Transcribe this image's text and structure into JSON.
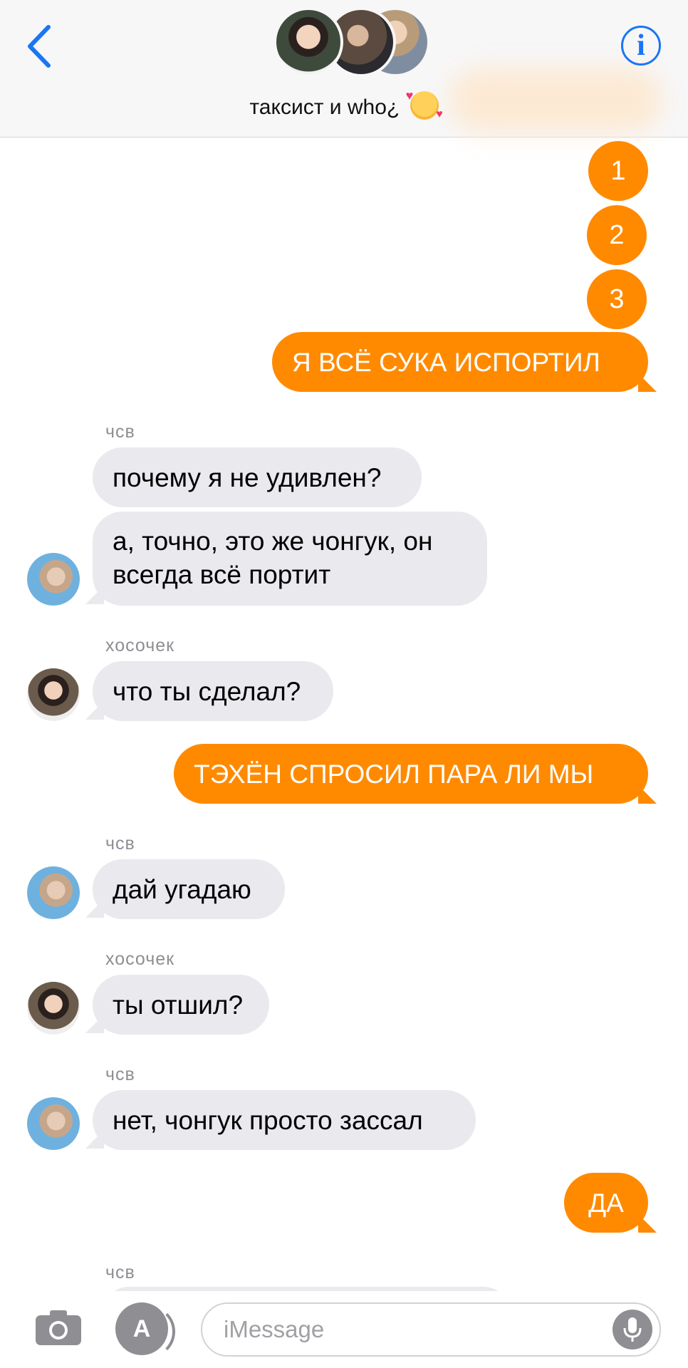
{
  "header": {
    "title": "таксист и who¿",
    "back_icon": "chevron-left",
    "info_icon": "info",
    "info_label": "i",
    "accent_color": "#1976f5"
  },
  "colors": {
    "outgoing": "#ff8a00",
    "incoming": "#e9e9ee",
    "sender_name": "#8e8e93"
  },
  "messages": [
    {
      "direction": "out",
      "text": "1"
    },
    {
      "direction": "out",
      "text": "2"
    },
    {
      "direction": "out",
      "text": "3"
    },
    {
      "direction": "out",
      "text": "Я ВСЁ СУКА ИСПОРТИЛ"
    },
    {
      "direction": "in",
      "sender": "чсв",
      "text": "почему я не удивлен?"
    },
    {
      "direction": "in",
      "sender": "чсв",
      "text": "а, точно, это же чонгук, он всегда всё портит"
    },
    {
      "direction": "in",
      "sender": "хосочек",
      "text": "что ты сделал?"
    },
    {
      "direction": "out",
      "text": "ТЭХЁН СПРОСИЛ ПАРА ЛИ МЫ"
    },
    {
      "direction": "in",
      "sender": "чсв",
      "text": "дай угадаю"
    },
    {
      "direction": "in",
      "sender": "хосочек",
      "text": "ты отшил?"
    },
    {
      "direction": "in",
      "sender": "чсв",
      "text": "нет, чонгук просто зассал"
    },
    {
      "direction": "out",
      "text": "ДА"
    },
    {
      "direction": "in",
      "sender": "чсв",
      "text": ""
    }
  ],
  "senders": {
    "chsv": "чсв",
    "hoso": "хосочек"
  },
  "composer": {
    "placeholder": "iMessage",
    "camera_icon": "camera",
    "apps_icon": "app-store",
    "mic_icon": "microphone"
  }
}
